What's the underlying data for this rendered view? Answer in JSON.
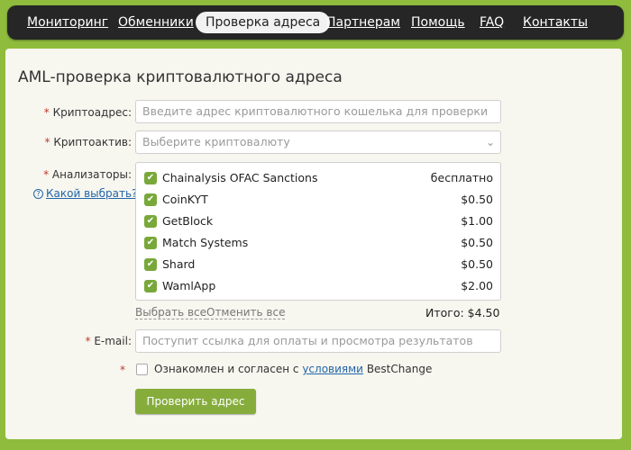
{
  "nav": {
    "items": [
      {
        "label": "Мониторинг"
      },
      {
        "label": "Обменники"
      },
      {
        "label": "Проверка адреса"
      },
      {
        "label": "Партнерам"
      },
      {
        "label": "Помощь"
      },
      {
        "label": "FAQ"
      },
      {
        "label": "Контакты"
      }
    ],
    "active_index": 2
  },
  "page": {
    "title": "AML-проверка криптовалютного адреса"
  },
  "form": {
    "required_mark": "*",
    "address": {
      "label": "Криптоадрес:",
      "placeholder": "Введите адрес криптовалютного кошелька для проверки"
    },
    "asset": {
      "label": "Криптоактив:",
      "placeholder": "Выберите криптовалюту"
    },
    "analyzers": {
      "label": "Анализаторы:",
      "help": "Какой выбрать?",
      "items": [
        {
          "name": "Chainalysis OFAC Sanctions",
          "price": "бесплатно",
          "checked": true
        },
        {
          "name": "CoinKYT",
          "price": "$0.50",
          "checked": true
        },
        {
          "name": "GetBlock",
          "price": "$1.00",
          "checked": true
        },
        {
          "name": "Match Systems",
          "price": "$0.50",
          "checked": true
        },
        {
          "name": "Shard",
          "price": "$0.50",
          "checked": true
        },
        {
          "name": "WamlApp",
          "price": "$2.00",
          "checked": true
        }
      ],
      "select_all": "Выбрать все",
      "deselect_all": "Отменить все",
      "total": "Итого: $4.50"
    },
    "email": {
      "label": "E-mail:",
      "placeholder": "Поступит ссылка для оплаты и просмотра результатов"
    },
    "consent": {
      "prefix": "Ознакомлен и согласен с",
      "link": "условиями",
      "suffix": "BestChange"
    },
    "submit_label": "Проверить адрес"
  },
  "colors": {
    "background": "#8fbc3d",
    "nav_bg": "#262626",
    "accent": "#79a83a",
    "link": "#2266aa",
    "required": "#c0392b"
  }
}
